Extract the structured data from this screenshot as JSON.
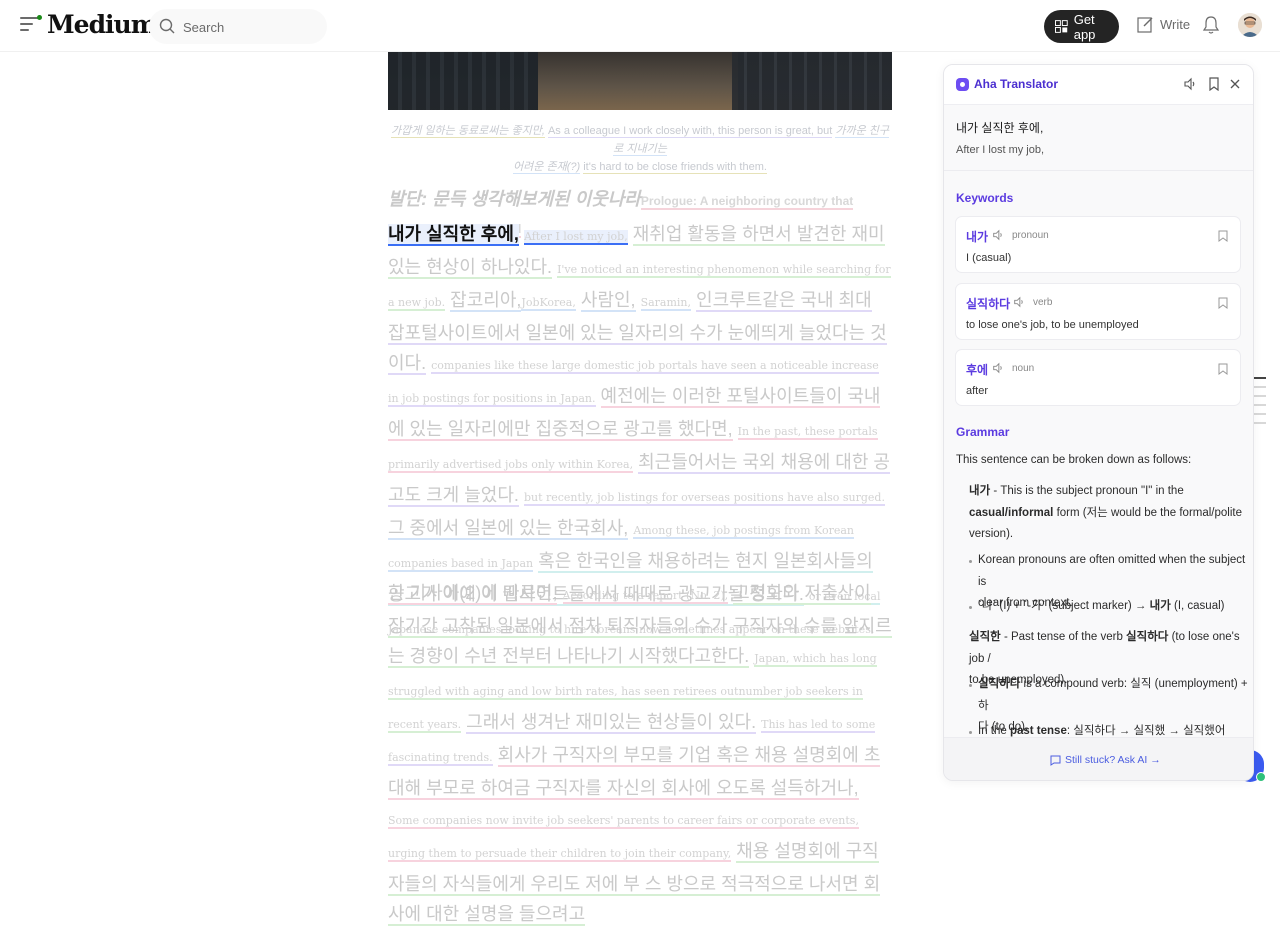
{
  "header": {
    "logo": "Medium",
    "search_placeholder": "Search",
    "get_app": "Get app",
    "write": "Write"
  },
  "article": {
    "caption": {
      "ko_line1": "가깝게 일하는 동료로써는 좋지만,",
      "en_line1": "As a colleague I work closely with, this person is great, but",
      "ko_line1b": "가까운 친구로 지내기는",
      "ko_line2": "어려운 존재(?)",
      "en_line2": "it's hard to be close friends with them."
    },
    "prologue": {
      "ko": "발단: 문득 생각해보게된 이웃나라",
      "en": "Prologue: A neighboring country that suddenly came to mind"
    },
    "p1": {
      "s1_ko": "내가 실직한 후에,",
      "s1_en": "After I lost my job,",
      "s2_ko": "재취업 활동을 하면서 발견한 재미있는 현상이 하나있다.",
      "s2_en": "I've noticed an interesting phenomenon while searching for a new job.",
      "s3_ko": "잡코리아,",
      "s3_en": "JobKorea,",
      "s4_ko": "사람인,",
      "s4_en": "Saramin,",
      "s5_ko": "인크루트같은 국내 최대 잡포털사이트에서 일본에 있는 일자리의 수가 눈에띄게 늘었다는 것이다.",
      "s5_en": "companies like these large domestic job portals have seen a noticeable increase in job postings for positions in Japan.",
      "s6_ko": "예전에는 이러한 포털사이트들이 국내에 있는 일자리에만 집중적으로 광고를 했다면,",
      "s6_en": "In the past, these portals primarily advertised jobs only within Korea,",
      "s7_ko": "최근들어서는 국외 채용에 대한 공고도 크게 늘었다.",
      "s7_en": "but recently, job listings for overseas positions have also surged.",
      "s8_ko": "그 중에서 일본에 있는 한국회사,",
      "s8_en": "Among these, job postings from Korean companies based in Japan",
      "s9_ko": "혹은 한국인을 채용하려는 현지 일본회사들의 공고가 아예 이 웹사이트들에서 때때로 광고가될 정도다.",
      "s9_en": "or even local Japanese companies looking to hire Koreans now sometimes appear on these websites."
    },
    "p2": {
      "s1_ko": "한 기사에(2)에 따르면,",
      "s1_en": "According to a report (No. 2),",
      "s2_ko": "고령화와 저출산이 장기간 고착된 일본에서 점차 퇴직자들의 수가 구직자의 수를 앞지르는 경향이 수년 전부터 나타나기 시작했다고한다.",
      "s2_en": "Japan, which has long struggled with aging and low birth rates, has seen retirees outnumber job seekers in recent years.",
      "s3_ko": "그래서 생겨난 재미있는 현상들이 있다.",
      "s3_en": "This has led to some fascinating trends.",
      "s4_ko": "회사가 구직자의 부모를 기업 혹은 채용 설명회에 초대해 부모로 하여금 구직자를 자신의 회사에 오도록 설득하거나,",
      "s4_en": "Some companies now invite job seekers' parents to career fairs or corporate events, urging them to persuade their children to join their company,",
      "s5_ko": "채용 설명회에 구직자들의 자식들에게 우리도 저에 부 스 방으로 적극적으로 나서면 회사에 대한 설명을 들으려고"
    }
  },
  "translator": {
    "title": "Aha Translator",
    "source": "내가 실직한 후에,",
    "translation": "After I lost my job,",
    "keywords_title": "Keywords",
    "keywords": [
      {
        "word": "내가",
        "pos": "pronoun",
        "meaning": "I (casual)"
      },
      {
        "word": "실직하다",
        "pos": "verb",
        "meaning": "to lose one's job, to be unemployed"
      },
      {
        "word": "후에",
        "pos": "noun",
        "meaning": "after"
      }
    ],
    "grammar_title": "Grammar",
    "grammar_intro": "This sentence can be broken down as follows:",
    "g1_word": "내가",
    "g1_text_a": " - This is the subject pronoun \"I\" in the",
    "g1_bold": "casual/informal",
    "g1_text_b": " form (저는 would be the formal/polite",
    "g1_text_c": "version).",
    "g1_b1_a": "Korean pronouns are often omitted when the subject is",
    "g1_b1_b": "clear from context.",
    "g1_b2_a": "`나` (I) + `-가` (subject marker) → ",
    "g1_b2_bold": "내가",
    "g1_b2_c": " (I, casual)",
    "g2_word": "실직한",
    "g2_text_a": " - Past tense of the verb ",
    "g2_bold": "실직하다",
    "g2_text_b": " (to lose one's job /",
    "g2_text_c": "to be unemployed).",
    "g2_b1_bold": "실직하다",
    "g2_b1_a": " is a compound verb: 실직 (unemployment) + 하",
    "g2_b1_b": "다 (to do).",
    "g2_b2_a": "In the ",
    "g2_b2_bold": "past tense",
    "g2_b2_c": ": 실직하다 → 실직했 → 실직했어",
    "footer": "Still stuck? Ask AI →"
  },
  "colors": {
    "accent": "#5b3be0",
    "active_underline": "#3b6ff5"
  }
}
